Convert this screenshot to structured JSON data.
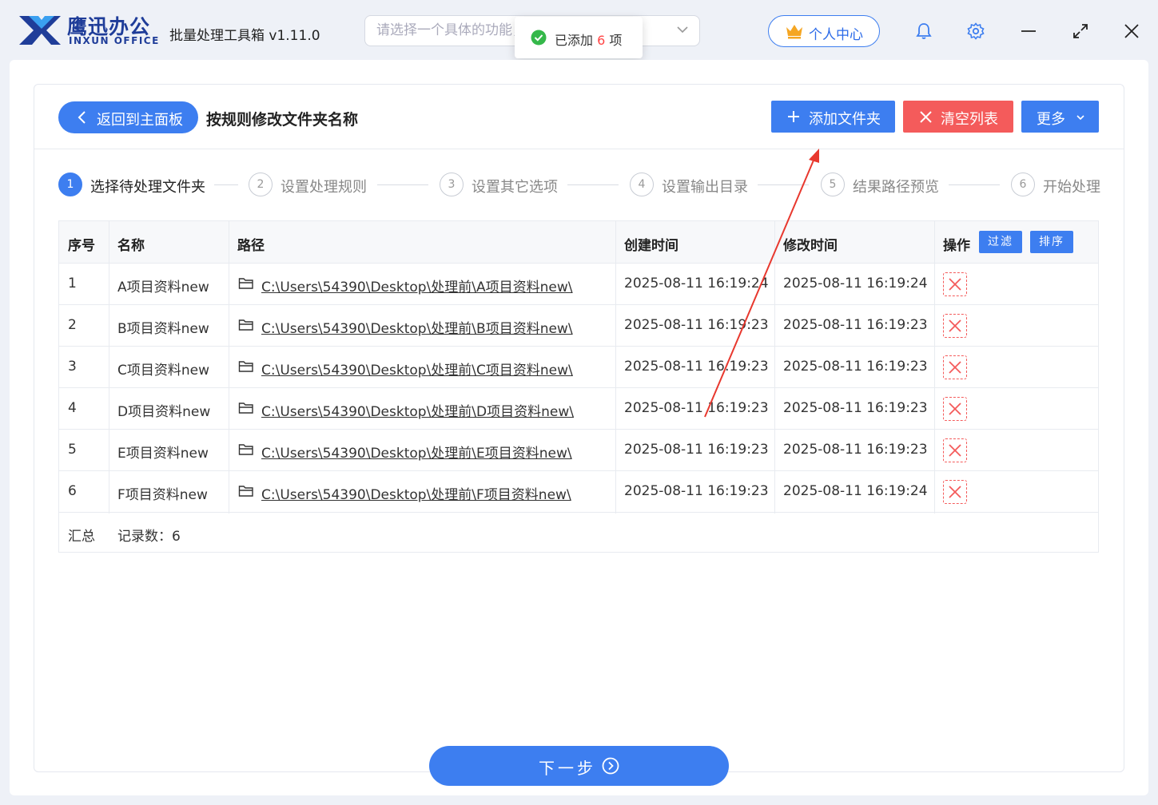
{
  "header": {
    "brand_cn": "鹰迅办公",
    "brand_en": "INXUN OFFICE",
    "app_title": "批量处理工具箱 v1.11.0",
    "search_placeholder": "请选择一个具体的功能，或输入关键字搜索!",
    "user_center": "个人中心"
  },
  "toast": {
    "prefix": "已添加",
    "count": "6",
    "suffix": "项"
  },
  "toolbar": {
    "back_label": "返回到主面板",
    "page_title": "按规则修改文件夹名称",
    "add_folder": "添加文件夹",
    "clear_list": "清空列表",
    "more": "更多"
  },
  "steps": [
    {
      "num": "1",
      "label": "选择待处理文件夹"
    },
    {
      "num": "2",
      "label": "设置处理规则"
    },
    {
      "num": "3",
      "label": "设置其它选项"
    },
    {
      "num": "4",
      "label": "设置输出目录"
    },
    {
      "num": "5",
      "label": "结果路径预览"
    },
    {
      "num": "6",
      "label": "开始处理"
    }
  ],
  "table": {
    "headers": {
      "index": "序号",
      "name": "名称",
      "path": "路径",
      "created": "创建时间",
      "modified": "修改时间",
      "action": "操作",
      "filter": "过滤",
      "sort": "排序"
    },
    "rows": [
      {
        "index": "1",
        "name": "A项目资料new",
        "path": "C:\\Users\\54390\\Desktop\\处理前\\A项目资料new\\",
        "created": "2025-08-11 16:19:24",
        "modified": "2025-08-11 16:19:24"
      },
      {
        "index": "2",
        "name": "B项目资料new",
        "path": "C:\\Users\\54390\\Desktop\\处理前\\B项目资料new\\",
        "created": "2025-08-11 16:19:23",
        "modified": "2025-08-11 16:19:23"
      },
      {
        "index": "3",
        "name": "C项目资料new",
        "path": "C:\\Users\\54390\\Desktop\\处理前\\C项目资料new\\",
        "created": "2025-08-11 16:19:23",
        "modified": "2025-08-11 16:19:23"
      },
      {
        "index": "4",
        "name": "D项目资料new",
        "path": "C:\\Users\\54390\\Desktop\\处理前\\D项目资料new\\",
        "created": "2025-08-11 16:19:23",
        "modified": "2025-08-11 16:19:23"
      },
      {
        "index": "5",
        "name": "E项目资料new",
        "path": "C:\\Users\\54390\\Desktop\\处理前\\E项目资料new\\",
        "created": "2025-08-11 16:19:23",
        "modified": "2025-08-11 16:19:23"
      },
      {
        "index": "6",
        "name": "F项目资料new",
        "path": "C:\\Users\\54390\\Desktop\\处理前\\F项目资料new\\",
        "created": "2025-08-11 16:19:23",
        "modified": "2025-08-11 16:19:24"
      }
    ],
    "footer": {
      "label": "汇总",
      "records": "记录数：6"
    }
  },
  "next_label": "下一步",
  "colors": {
    "primary": "#3d7ef0",
    "danger": "#f45b5b",
    "brand": "#1f3d99"
  }
}
